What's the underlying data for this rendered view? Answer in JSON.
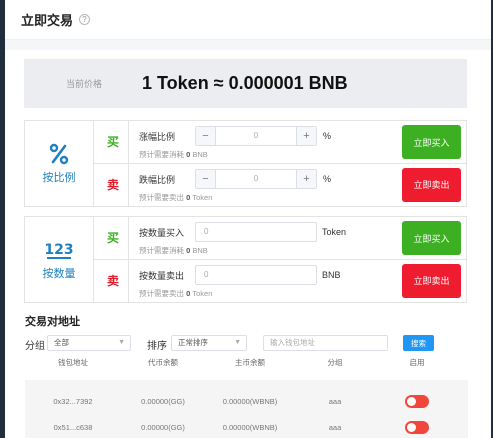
{
  "header": {
    "title": "立即交易",
    "help_icon": "?"
  },
  "price": {
    "label": "当前价格",
    "value": "1 Token ≈ 0.000001 BNB"
  },
  "ratio_mode": {
    "icon": "percent-icon",
    "icon_glyph": "%",
    "label": "按比例",
    "buy": {
      "side": "买",
      "label": "涨幅比例",
      "minus": "−",
      "value": "0",
      "plus": "+",
      "unit": "%",
      "hint_prefix": "预计需要消耗",
      "hint_amount": "0",
      "hint_unit": "BNB",
      "button": "立即买入"
    },
    "sell": {
      "side": "卖",
      "label": "跌幅比例",
      "minus": "−",
      "value": "0",
      "plus": "+",
      "unit": "%",
      "hint_prefix": "预计需要卖出",
      "hint_amount": "0",
      "hint_unit": "Token",
      "button": "立即卖出"
    }
  },
  "quantity_mode": {
    "icon": "number-123-icon",
    "icon_glyph": "123",
    "label": "按数量",
    "buy": {
      "side": "买",
      "label": "按数量买入",
      "value": "0",
      "unit": "Token",
      "hint_prefix": "预计需要消耗",
      "hint_amount": "0",
      "hint_unit": "BNB",
      "button": "立即买入"
    },
    "sell": {
      "side": "卖",
      "label": "按数量卖出",
      "value": "0",
      "unit": "BNB",
      "hint_prefix": "预计需要卖出",
      "hint_amount": "0",
      "hint_unit": "Token",
      "button": "立即卖出"
    }
  },
  "address_section": {
    "title": "交易对地址",
    "group_label": "分组",
    "group_value": "全部",
    "sort_label": "排序",
    "sort_value": "正常排序",
    "address_placeholder": "输入钱包地址",
    "search_button": "搜索",
    "columns": [
      "钱包地址",
      "代币余额",
      "主币余额",
      "分组",
      "启用"
    ],
    "rows": [
      {
        "address": "0x32...7392",
        "token_balance": "0.00000(GG)",
        "main_balance": "0.00000(WBNB)",
        "group": "aaa",
        "enabled": false
      },
      {
        "address": "0x51...c638",
        "token_balance": "0.00000(GG)",
        "main_balance": "0.00000(WBNB)",
        "group": "aaa",
        "enabled": false
      }
    ]
  },
  "colors": {
    "buy": "#3cb022",
    "sell": "#ee1c2e",
    "accent": "#1f7fc1",
    "search": "#2196f3",
    "toggle": "#f0463c"
  }
}
